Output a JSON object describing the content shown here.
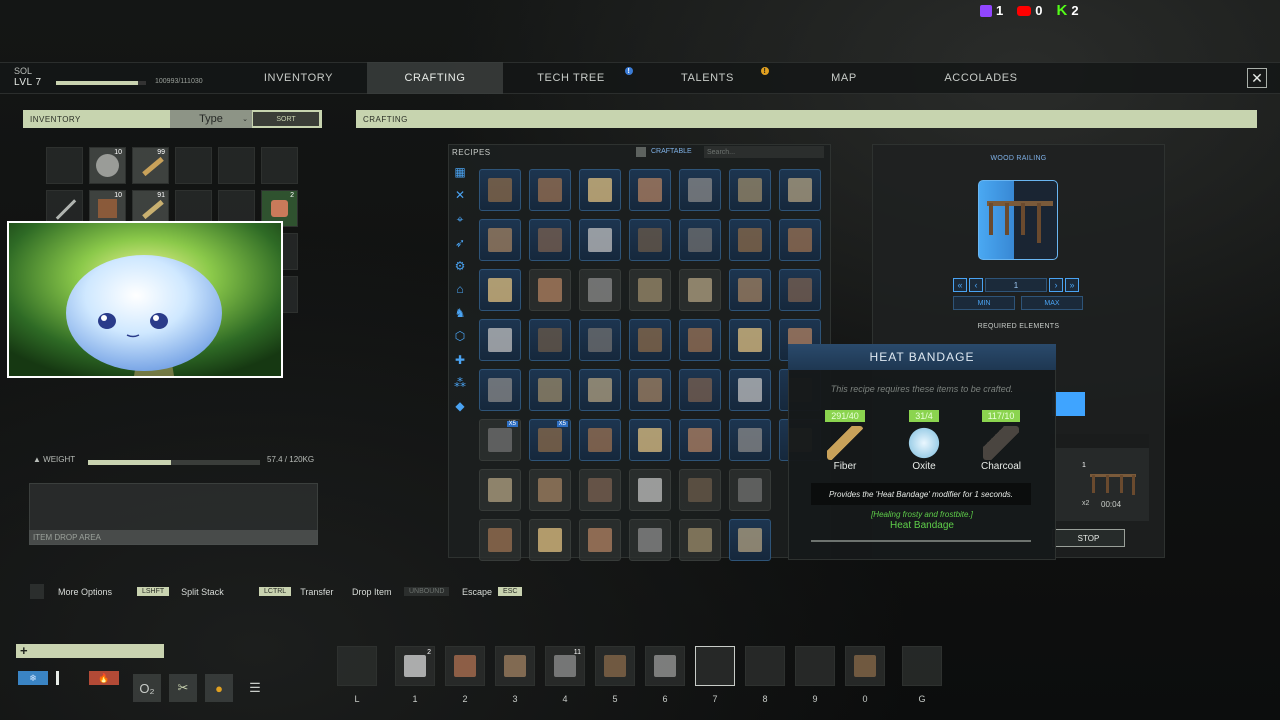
{
  "stream": {
    "twitch": "1",
    "youtube": "0",
    "kick": "2"
  },
  "player": {
    "name": "SOL",
    "level": "LVL 7",
    "xp": "100993/111030",
    "xp_fraction": 0.91
  },
  "tabs": [
    {
      "label": "INVENTORY",
      "active": false
    },
    {
      "label": "CRAFTING",
      "active": true
    },
    {
      "label": "TECH TREE",
      "active": false,
      "alert": "!"
    },
    {
      "label": "TALENTS",
      "active": false,
      "alert": "!"
    },
    {
      "label": "MAP",
      "active": false
    },
    {
      "label": "ACCOLADES",
      "active": false
    }
  ],
  "close_label": "✕",
  "inventory": {
    "header": "INVENTORY",
    "sort_type": "Type",
    "sort_label": "SORT",
    "slot_counts": [
      "",
      "10",
      "99",
      "",
      "",
      "",
      "",
      "10",
      "91",
      "",
      "",
      "2"
    ],
    "weight_label": "WEIGHT",
    "weight_value": "57.4 / 120KG",
    "weight_fraction": 0.48,
    "drop_area": "ITEM DROP AREA"
  },
  "crafting": {
    "header": "CRAFTING",
    "recipes_title": "RECIPES",
    "craftable_label": "CRAFTABLE",
    "search_placeholder": "Search...",
    "x5_badge": "X5"
  },
  "detail": {
    "title": "WOOD RAILING",
    "quantity": "1",
    "min_label": "MIN",
    "max_label": "MAX",
    "required_label": "REQUIRED ELEMENTS",
    "queue_count": "1",
    "queue_multiplier": "x2",
    "queue_time": "00:04",
    "stop_label": "STOP"
  },
  "tooltip": {
    "title": "HEAT BANDAGE",
    "subtitle": "This recipe requires these items to be crafted.",
    "materials": [
      {
        "count": "291/40",
        "name": "Fiber",
        "color": "#c9a25a"
      },
      {
        "count": "31/4",
        "name": "Oxite",
        "color": "#bfe2f2"
      },
      {
        "count": "117/10",
        "name": "Charcoal",
        "color": "#4a4540"
      }
    ],
    "description": "Provides the 'Heat Bandage' modifier for 1 seconds.",
    "effect": "[Healing frosty and frostbite.]",
    "modifier": "Heat Bandage"
  },
  "keybinds": [
    {
      "key": "",
      "text": "More Options"
    },
    {
      "key": "LSHFT",
      "text": "Split Stack"
    },
    {
      "key": "LCTRL",
      "text": "Transfer"
    },
    {
      "key": "",
      "text": "Drop Item"
    },
    {
      "key": "UNBOUND",
      "text": ""
    },
    {
      "key": "",
      "text": "Escape"
    },
    {
      "key": "ESC",
      "text": ""
    }
  ],
  "hotbar": [
    {
      "num": "L",
      "count": ""
    },
    {
      "num": "1",
      "count": "2"
    },
    {
      "num": "2",
      "count": ""
    },
    {
      "num": "3",
      "count": ""
    },
    {
      "num": "4",
      "count": "11"
    },
    {
      "num": "5",
      "count": ""
    },
    {
      "num": "6",
      "count": ""
    },
    {
      "num": "7",
      "count": ""
    },
    {
      "num": "8",
      "count": ""
    },
    {
      "num": "9",
      "count": ""
    },
    {
      "num": "0",
      "count": ""
    },
    {
      "num": "G",
      "count": ""
    }
  ],
  "vitals": {
    "health_symbol": "+",
    "cold_symbol": "❄",
    "heat_symbol": "🔥",
    "o2_label": "O₂"
  }
}
